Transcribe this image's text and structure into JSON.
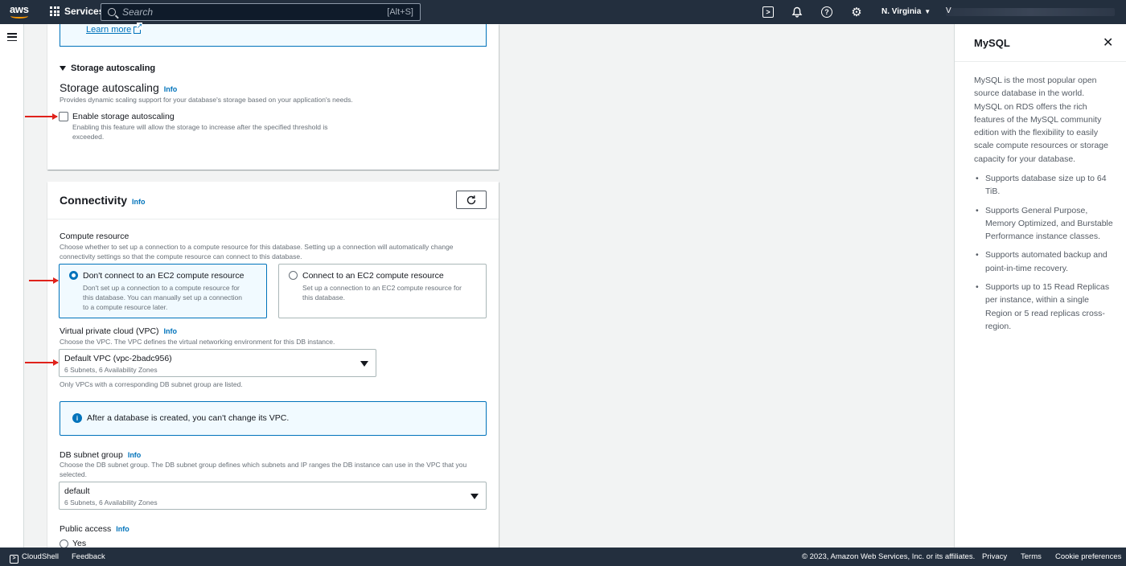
{
  "nav": {
    "logo": "aws",
    "services_label": "Services",
    "search_placeholder": "Search",
    "search_shortcut": "[Alt+S]",
    "region_label": "N. Virginia",
    "account_initial": "V"
  },
  "storage": {
    "learn_more": "Learn more",
    "section_toggle": "Storage autoscaling",
    "heading": "Storage autoscaling",
    "info": "Info",
    "description": "Provides dynamic scaling support for your database's storage based on your application's needs.",
    "checkbox_label": "Enable storage autoscaling",
    "checkbox_checked": false,
    "checkbox_desc_line1": "Enabling this feature will allow the storage to increase after the specified threshold is",
    "checkbox_desc_line2": "exceeded."
  },
  "connectivity": {
    "heading": "Connectivity",
    "info": "Info",
    "compute": {
      "label": "Compute resource",
      "desc_line1": "Choose whether to set up a connection to a compute resource for this database. Setting up a connection will automatically change",
      "desc_line2": "connectivity settings so that the compute resource can connect to this database.",
      "options": [
        {
          "title": "Don't connect to an EC2 compute resource",
          "desc": [
            "Don't set up a connection to a compute resource for",
            "this database. You can manually set up a connection",
            "to a compute resource later."
          ],
          "selected": true
        },
        {
          "title": "Connect to an EC2 compute resource",
          "desc": [
            "Set up a connection to an EC2 compute resource for",
            "this database."
          ],
          "selected": false
        }
      ]
    },
    "vpc": {
      "label": "Virtual private cloud (VPC)",
      "info": "Info",
      "desc": "Choose the VPC. The VPC defines the virtual networking environment for this DB instance.",
      "value": "Default VPC (vpc-2badc956)",
      "sub": "6 Subnets, 6 Availability Zones",
      "note": "Only VPCs with a corresponding DB subnet group are listed."
    },
    "alert": "After a database is created, you can't change its VPC.",
    "subnet": {
      "label": "DB subnet group",
      "info": "Info",
      "desc_line1": "Choose the DB subnet group. The DB subnet group defines which subnets and IP ranges the DB instance can use in the VPC that you",
      "desc_line2": "selected.",
      "value": "default",
      "sub": "6 Subnets, 6 Availability Zones"
    },
    "public_access": {
      "label": "Public access",
      "info": "Info",
      "option_yes": "Yes"
    }
  },
  "help": {
    "title": "MySQL",
    "paragraph": "MySQL is the most popular open source database in the world. MySQL on RDS offers the rich features of the MySQL community edition with the flexibility to easily scale compute resources or storage capacity for your database.",
    "bullets": [
      "Supports database size up to 64 TiB.",
      "Supports General Purpose, Memory Optimized, and Burstable Performance instance classes.",
      "Supports automated backup and point-in-time recovery.",
      "Supports up to 15 Read Replicas per instance, within a single Region or 5 read replicas cross-region."
    ]
  },
  "footer": {
    "cloudshell": "CloudShell",
    "feedback": "Feedback",
    "copyright": "© 2023, Amazon Web Services, Inc. or its affiliates.",
    "privacy": "Privacy",
    "terms": "Terms",
    "cookies": "Cookie preferences"
  },
  "colors": {
    "nav_bg": "#232f3e",
    "link": "#0073bb",
    "annotation_arrow": "#e0221b"
  }
}
